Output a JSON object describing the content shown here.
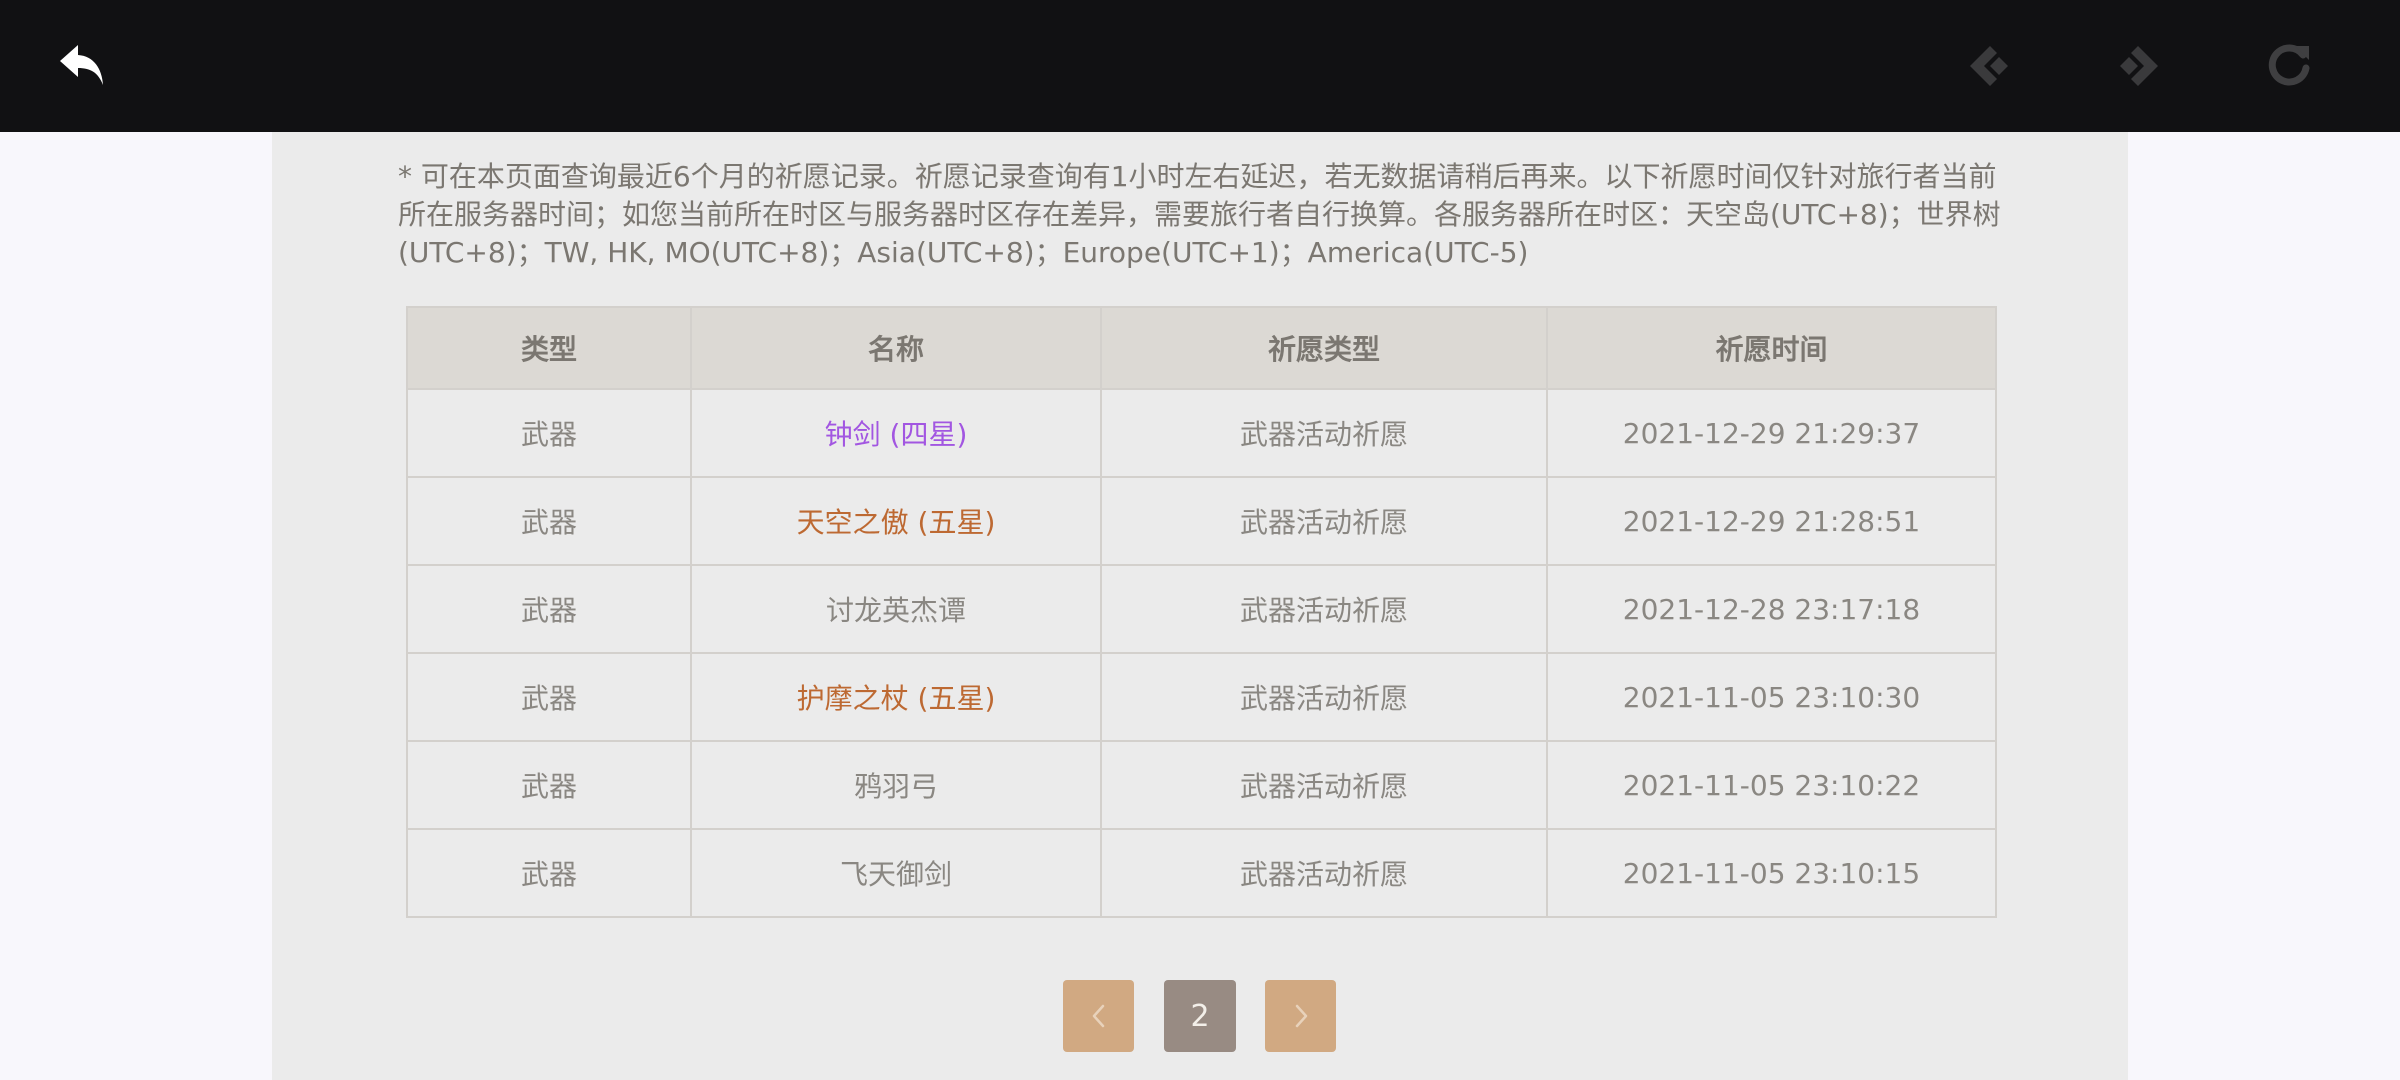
{
  "toolbar": {
    "back_icon": "undo-arrow-icon",
    "prev_icon": "back-nav-icon",
    "next_icon": "forward-nav-icon",
    "reload_icon": "refresh-icon"
  },
  "notice": {
    "text": "* 可在本页面查询最近6个月的祈愿记录。祈愿记录查询有1小时左右延迟，若无数据请稍后再来。以下祈愿时间仅针对旅行者当前所在服务器时间；如您当前所在时区与服务器时区存在差异，需要旅行者自行换算。各服务器所在时区：天空岛(UTC+8)；世界树(UTC+8)；TW, HK, MO(UTC+8)；Asia(UTC+8)；Europe(UTC+1)；America(UTC-5)"
  },
  "table": {
    "headers": [
      "类型",
      "名称",
      "祈愿类型",
      "祈愿时间"
    ],
    "rows": [
      {
        "type": "武器",
        "name": "钟剑 (四星)",
        "wish_type": "武器活动祈愿",
        "time": "2021-12-29 21:29:37",
        "color": "#a256e1"
      },
      {
        "type": "武器",
        "name": "天空之傲 (五星)",
        "wish_type": "武器活动祈愿",
        "time": "2021-12-29 21:28:51",
        "color": "#bd6932"
      },
      {
        "type": "武器",
        "name": "讨龙英杰谭",
        "wish_type": "武器活动祈愿",
        "time": "2021-12-28 23:17:18",
        "color": "#8a8782"
      },
      {
        "type": "武器",
        "name": "护摩之杖 (五星)",
        "wish_type": "武器活动祈愿",
        "time": "2021-11-05 23:10:30",
        "color": "#bd6932"
      },
      {
        "type": "武器",
        "name": "鸦羽弓",
        "wish_type": "武器活动祈愿",
        "time": "2021-11-05 23:10:22",
        "color": "#8a8782"
      },
      {
        "type": "武器",
        "name": "飞天御剑",
        "wish_type": "武器活动祈愿",
        "time": "2021-11-05 23:10:15",
        "color": "#8a8782"
      }
    ]
  },
  "pagination": {
    "current_page": "2",
    "prev_icon": "chevron-left-icon",
    "next_icon": "chevron-right-icon"
  }
}
